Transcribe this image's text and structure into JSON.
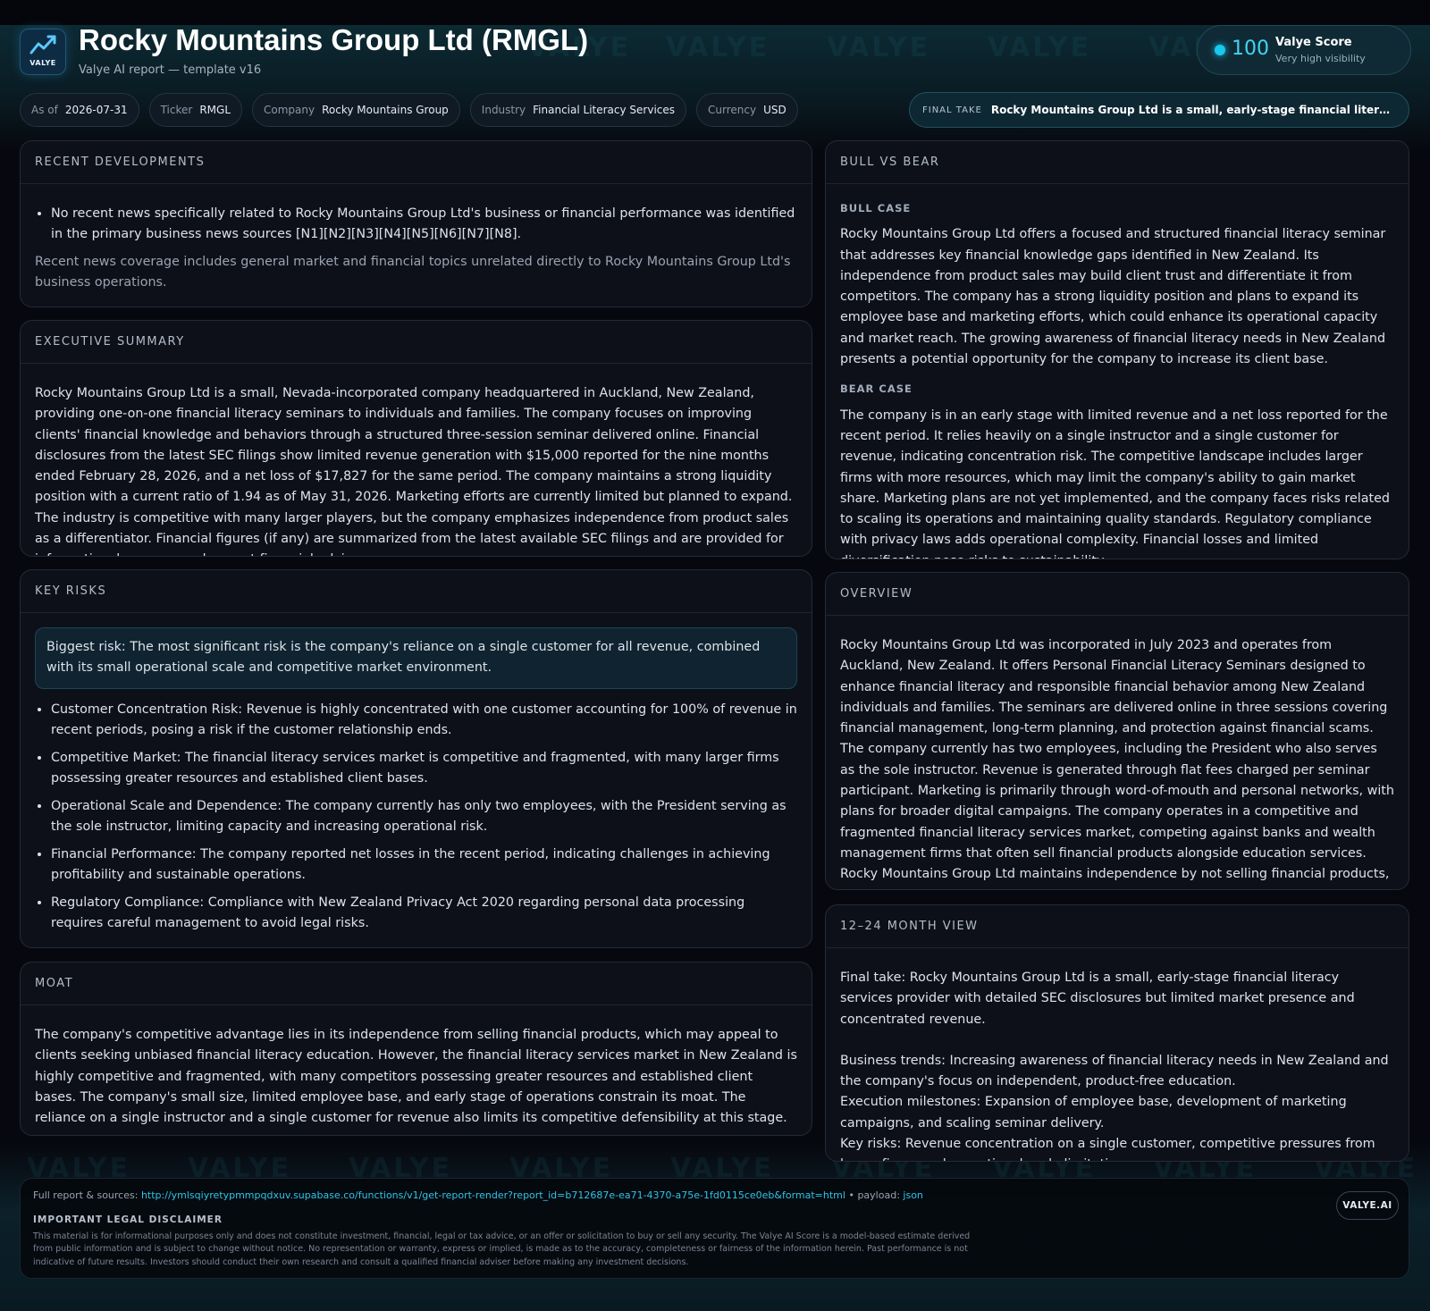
{
  "colors": {
    "accent": "#19c8ee",
    "background": "#07080f",
    "panel": "#0e1019",
    "link": "#2fc4ea"
  },
  "header": {
    "logo_text": "VALYE",
    "logo_icon": "valye-chart-icon",
    "title": "Rocky Mountains Group Ltd (RMGL)",
    "subtitle": "Valye AI report — template v16",
    "watermark": "VALYE"
  },
  "score": {
    "value": "100",
    "label": "Valye Score",
    "sub": "Very high visibility"
  },
  "chips": [
    {
      "key": "As of",
      "value": "2026-07-31"
    },
    {
      "key": "Ticker",
      "value": "RMGL"
    },
    {
      "key": "Company",
      "value": "Rocky Mountains Group"
    },
    {
      "key": "Industry",
      "value": "Financial Literacy Services"
    },
    {
      "key": "Currency",
      "value": "USD"
    }
  ],
  "final_take_pill": {
    "label": "FINAL TAKE",
    "text": "Rocky Mountains Group Ltd is a small, early-stage financial literacy services provider with detailed SEC disclosures but limited market presence and concentrated revenue."
  },
  "recent": {
    "heading": "RECENT DEVELOPMENTS",
    "bullets": [
      "No recent news specifically related to Rocky Mountains Group Ltd's business or financial performance was identified in the primary business news sources [N1][N2][N3][N4][N5][N6][N7][N8]."
    ],
    "note": "Recent news coverage includes general market and financial topics unrelated directly to Rocky Mountains Group Ltd's business operations."
  },
  "executive": {
    "heading": "EXECUTIVE SUMMARY",
    "text": "Rocky Mountains Group Ltd is a small, Nevada-incorporated company headquartered in Auckland, New Zealand, providing one-on-one financial literacy seminars to individuals and families. The company focuses on improving clients' financial knowledge and behaviors through a structured three-session seminar delivered online. Financial disclosures from the latest SEC filings show limited revenue generation with $15,000 reported for the nine months ended February 28, 2026, and a net loss of $17,827 for the same period. The company maintains a strong liquidity position with a current ratio of 1.94 as of May 31, 2026. Marketing efforts are currently limited but planned to expand. The industry is competitive with many larger players, but the company emphasizes independence from product sales as a differentiator. Financial figures (if any) are summarized from the latest available SEC filings and are provided for informational purposes only — not financial advice."
  },
  "risks": {
    "heading": "KEY RISKS",
    "biggest": "Biggest risk: The most significant risk is the company's reliance on a single customer for all revenue, combined with its small operational scale and competitive market environment.",
    "bullets": [
      "Customer Concentration Risk: Revenue is highly concentrated with one customer accounting for 100% of revenue in recent periods, posing a risk if the customer relationship ends.",
      "Competitive Market: The financial literacy services market is competitive and fragmented, with many larger firms possessing greater resources and established client bases.",
      "Operational Scale and Dependence: The company currently has only two employees, with the President serving as the sole instructor, limiting capacity and increasing operational risk.",
      "Financial Performance: The company reported net losses in the recent period, indicating challenges in achieving profitability and sustainable operations.",
      "Regulatory Compliance: Compliance with New Zealand Privacy Act 2020 regarding personal data processing requires careful management to avoid legal risks."
    ]
  },
  "moat": {
    "heading": "MOAT",
    "text": "The company's competitive advantage lies in its independence from selling financial products, which may appeal to clients seeking unbiased financial literacy education. However, the financial literacy services market in New Zealand is highly competitive and fragmented, with many competitors possessing greater resources and established client bases. The company's small size, limited employee base, and early stage of operations constrain its moat. The reliance on a single instructor and a single customer for revenue also limits its competitive defensibility at this stage."
  },
  "bullbear": {
    "heading": "BULL VS BEAR",
    "bull_label": "BULL CASE",
    "bull": "Rocky Mountains Group Ltd offers a focused and structured financial literacy seminar that addresses key financial knowledge gaps identified in New Zealand. Its independence from product sales may build client trust and differentiate it from competitors. The company has a strong liquidity position and plans to expand its employee base and marketing efforts, which could enhance its operational capacity and market reach. The growing awareness of financial literacy needs in New Zealand presents a potential opportunity for the company to increase its client base.",
    "bear_label": "BEAR CASE",
    "bear": "The company is in an early stage with limited revenue and a net loss reported for the recent period. It relies heavily on a single instructor and a single customer for revenue, indicating concentration risk. The competitive landscape includes larger firms with more resources, which may limit the company's ability to gain market share. Marketing plans are not yet implemented, and the company faces risks related to scaling its operations and maintaining quality standards. Regulatory compliance with privacy laws adds operational complexity. Financial losses and limited diversification pose risks to sustainability."
  },
  "overview": {
    "heading": "OVERVIEW",
    "text": "Rocky Mountains Group Ltd was incorporated in July 2023 and operates from Auckland, New Zealand. It offers Personal Financial Literacy Seminars designed to enhance financial literacy and responsible financial behavior among New Zealand individuals and families. The seminars are delivered online in three sessions covering financial management, long-term planning, and protection against financial scams. The company currently has two employees, including the President who also serves as the sole instructor. Revenue is generated through flat fees charged per seminar participant. Marketing is primarily through word-of-mouth and personal networks, with plans for broader digital campaigns. The company operates in a competitive and fragmented financial literacy services market, competing against banks and wealth management firms that often sell financial products alongside education services. Rocky Mountains Group Ltd maintains independence by not selling financial products, aiming to avoid conflicts of interest and build client trust."
  },
  "view": {
    "heading": "12–24 MONTH VIEW",
    "final": "Final take: Rocky Mountains Group Ltd is a small, early-stage financial literacy services provider with detailed SEC disclosures but limited market presence and concentrated revenue.",
    "trends": "Business trends: Increasing awareness of financial literacy needs in New Zealand and the company's focus on independent, product-free education.",
    "milestones": "Execution milestones: Expansion of employee base, development of marketing campaigns, and scaling seminar delivery.",
    "risks": "Key risks: Revenue concentration on a single customer, competitive pressures from larger firms, and operational scale limitations."
  },
  "footer": {
    "src_label": "Full report & sources:",
    "url": "http://ymlsqiyretypmmpqdxuv.supabase.co/functions/v1/get-report-render?report_id=b712687e-ea71-4370-a75e-1fd0115ce0eb&format=html",
    "payload_sep": "• payload:",
    "payload_link": "json",
    "disclaimer_heading": "IMPORTANT LEGAL DISCLAIMER",
    "disclaimer": "This material is for informational purposes only and does not constitute investment, financial, legal or tax advice, or an offer or solicitation to buy or sell any security. The Valye AI Score is a model-based estimate derived from public information and is subject to change without notice. No representation or warranty, express or implied, is made as to the accuracy, completeness or fairness of the information herein. Past performance is not indicative of future results. Investors should conduct their own research and consult a qualified financial adviser before making any investment decisions.",
    "brand": "VALYE.AI"
  }
}
